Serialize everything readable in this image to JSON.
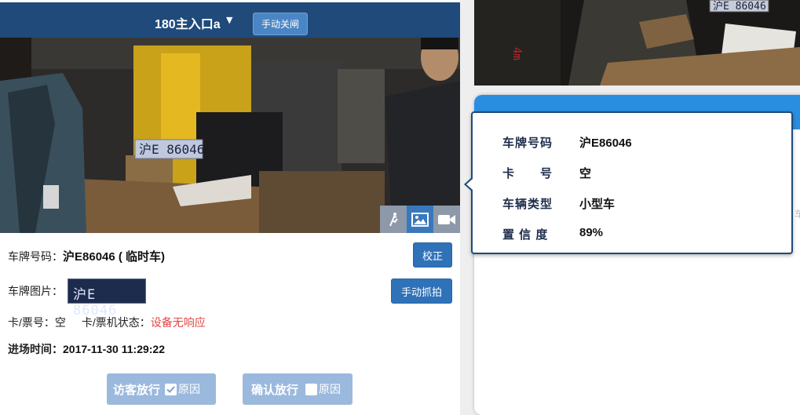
{
  "header": {
    "gate_name": "180主入口a",
    "caret": "▼",
    "close_gate_button": "手动关闸"
  },
  "camera": {
    "plate_text_in_scene": "沪E 86046",
    "toolbar": [
      "run-icon",
      "image-icon",
      "video-icon"
    ]
  },
  "details": {
    "plate_label": "车牌号码：",
    "plate_value": "沪E86046 ( 临时车)",
    "correct_button": "校正",
    "plate_image_label": "车牌图片：",
    "plate_image_text": "沪E 86046",
    "manual_capture_button": "手动抓拍",
    "card_label": "卡/票号：",
    "card_value": "空",
    "machine_status_label": "卡/票机状态：",
    "machine_status_value": "设备无响应",
    "entry_time_label": "进场时间：",
    "entry_time_value": "2017-11-30 11:29:22"
  },
  "actions": {
    "visitor_release": "访客放行",
    "visitor_reason": "原因",
    "visitor_reason_checked": true,
    "confirm_release": "确认放行",
    "confirm_reason": "原因",
    "confirm_reason_checked": false
  },
  "right": {
    "cam_plate_text": "沪E 86046",
    "side_char": "车"
  },
  "popup": {
    "plate_label": "车牌号码",
    "plate_value": "沪E86046",
    "card_label": "卡　　号",
    "card_value": "空",
    "vehicle_type_label": "车辆类型",
    "vehicle_type_value": "小型车",
    "confidence_label": "置 信 度",
    "confidence_value": "89%"
  },
  "colors": {
    "header_bg": "#1f4a7a",
    "primary_button": "#2f72b8",
    "release_button": "#9bb9dd",
    "status_error": "#e64545",
    "card_header": "#2a8ee0"
  }
}
